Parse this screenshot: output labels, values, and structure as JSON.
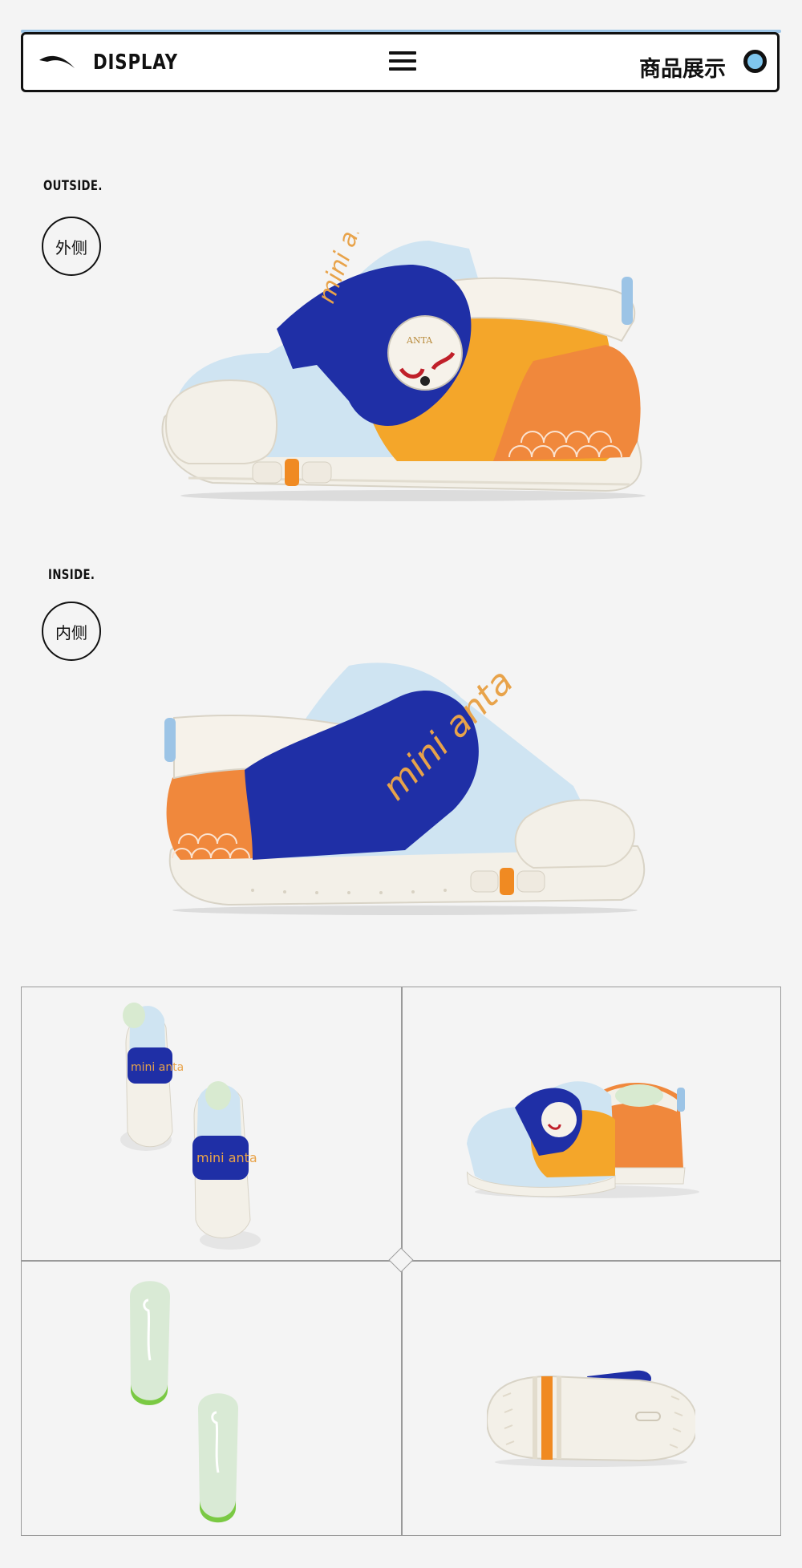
{
  "header": {
    "title": "DISPLAY",
    "cn_title": "商品展示",
    "icons": [
      "anta-logo",
      "menu-icon",
      "circle-dot-icon"
    ]
  },
  "sections": {
    "outside": {
      "label": "OUTSIDE.",
      "badge": "外侧"
    },
    "inside": {
      "label": "INSIDE.",
      "badge": "内侧"
    }
  },
  "product": {
    "tongue_text": "mini anta",
    "patch_text": "ANTA"
  },
  "colors": {
    "navy": "#1f2fa6",
    "orange": "#f0883c",
    "yellow": "#f4a62a",
    "light_blue": "#cfe4f2",
    "cream": "#f3f0e8",
    "insole_green": "#d9ead5",
    "accent_blue": "#9cc4e6"
  }
}
